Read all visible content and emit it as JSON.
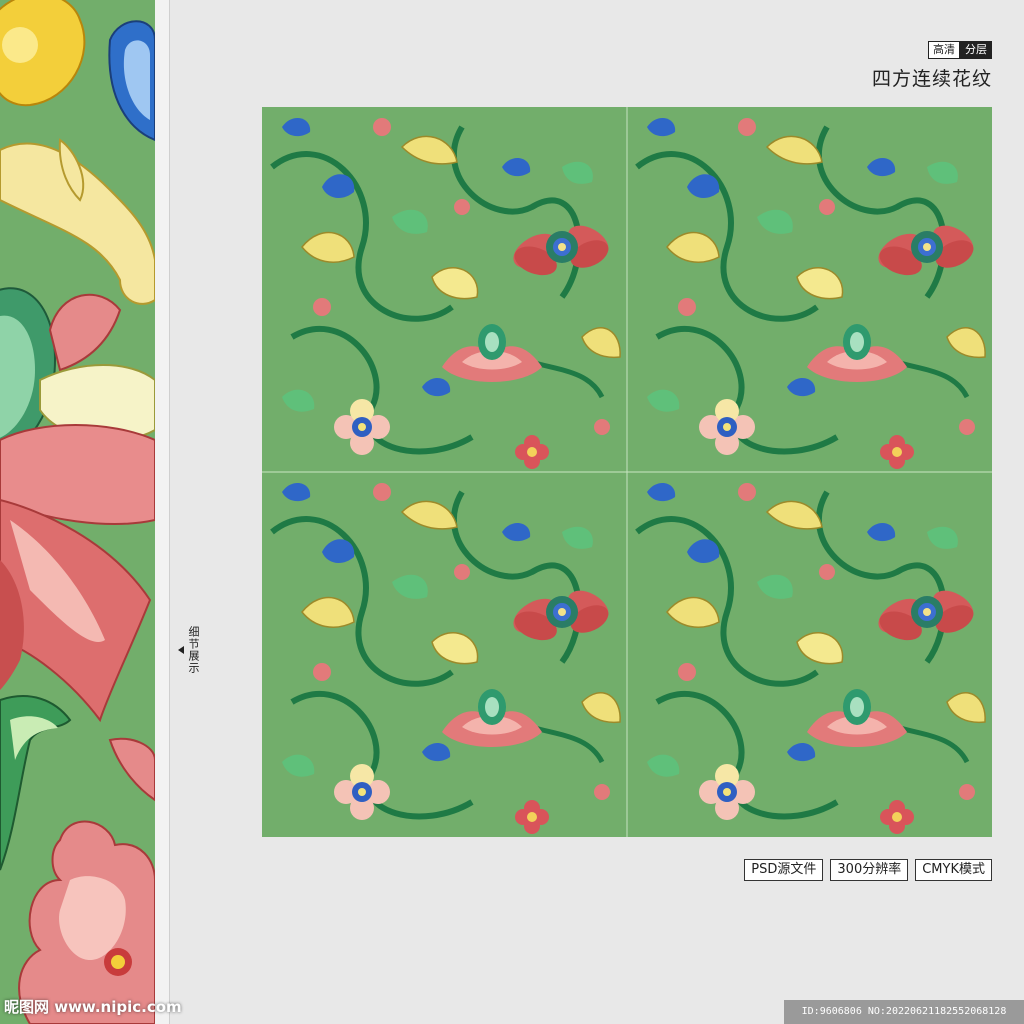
{
  "detail_label": "细节展示",
  "badges": {
    "hd": "高清",
    "layered": "分层"
  },
  "title": "四方连续花纹",
  "spec_tags": [
    "PSD源文件",
    "300分辨率",
    "CMYK模式"
  ],
  "watermark": "昵图网 www.nipic.com",
  "image_id": "ID:9606806 NO:20220621182552068128",
  "colors": {
    "pattern_bg": "#72ae6b",
    "page_bg": "#e8e8e8"
  }
}
